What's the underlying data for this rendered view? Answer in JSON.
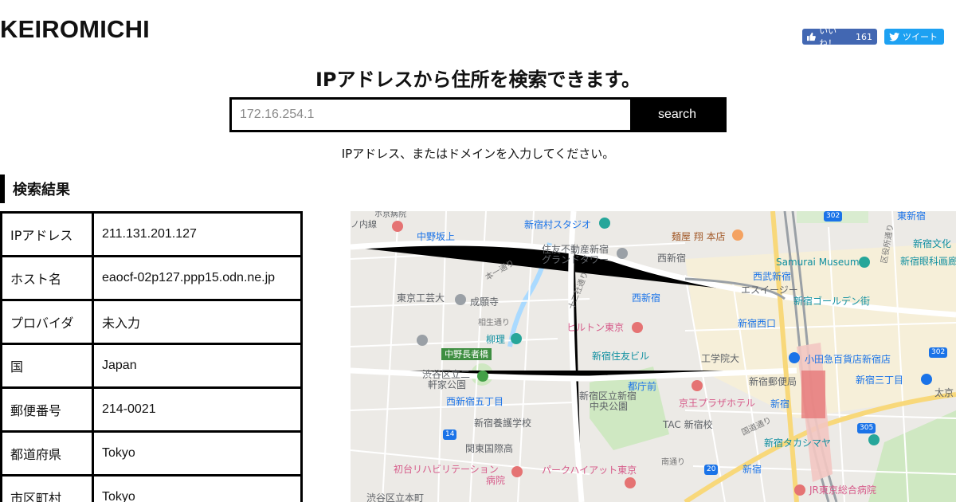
{
  "site": {
    "logo": "KEIROMICHI"
  },
  "share": {
    "fb_label": "いいね！",
    "fb_count": "161",
    "tw_label": "ツイート"
  },
  "headline": "IPアドレスから住所を検索できます。",
  "search": {
    "placeholder": "172.16.254.1",
    "button": "search",
    "hint": "IPアドレス、またはドメインを入力してください。"
  },
  "results": {
    "title": "検索結果",
    "rows": [
      {
        "key": "IPアドレス",
        "value": "211.131.201.127"
      },
      {
        "key": "ホスト名",
        "value": "eaocf-02p127.ppp15.odn.ne.jp"
      },
      {
        "key": "プロバイダ",
        "value": "未入力"
      },
      {
        "key": "国",
        "value": "Japan"
      },
      {
        "key": "郵便番号",
        "value": "214-0021"
      },
      {
        "key": "都道府県",
        "value": "Tokyo"
      },
      {
        "key": "市区町村",
        "value": "Tokyo"
      }
    ]
  },
  "map": {
    "labels": {
      "l1": "中野坂上",
      "l2": "新宿村スタジオ",
      "l3": "麺屋 翔 本店",
      "l4": "東新宿",
      "l5": "住友不動産新宿",
      "l5b": "グランドタワー",
      "l6": "西新宿",
      "l7": "新宿文化",
      "l8": "Samurai Museum",
      "l9": "新宿眼科画廊",
      "l10": "西武新宿",
      "l11": "東京工芸大",
      "l12": "成願寺",
      "l13": "西新宿",
      "l14": "エスイージー",
      "l15": "新宿ゴールデン街",
      "l16": "柳理",
      "l17": "ヒルトン東京",
      "l18": "新宿西口",
      "l19": "中野長者橋",
      "l20": "新宿住友ビル",
      "l21": "工学院大",
      "l22": "小田急百貨店新宿店",
      "l23": "渋谷区立二",
      "l23b": "軒家公園",
      "l24": "都庁前",
      "l25": "新宿郵便局",
      "l26": "新宿三丁目",
      "l27": "西新宿五丁目",
      "l28": "新宿区立新宿",
      "l28b": "中央公園",
      "l29": "京王プラザホテル",
      "l30": "新宿",
      "l31": "新宿養護学校",
      "l32": "TAC 新宿校",
      "l33": "関東国際高",
      "l34": "新宿タカシマヤ",
      "l35": "初台リハビリテーション",
      "l35b": "病院",
      "l36": "パークハイアット東京",
      "l37": "新宿",
      "l38": "JR東京総合病院",
      "l39": "渋谷区立本町",
      "l40": "太京",
      "road1": "十二社通り",
      "road2": "区役所通り",
      "road3": "相生通り",
      "road4": "本一通り",
      "road5": "南通り",
      "road6": "国道通り",
      "route14": "14",
      "route20": "20",
      "route302a": "302",
      "route302b": "302",
      "route305": "305",
      "l0": "ノ内線",
      "l0b": "ホ京病院"
    },
    "colors": {
      "park": "#cfe8c2",
      "water": "#aadaff",
      "road": "#ffffff",
      "major_road": "#f8d87a",
      "rail": "#9aa0a6",
      "station_area": "#f3c6c2"
    }
  }
}
